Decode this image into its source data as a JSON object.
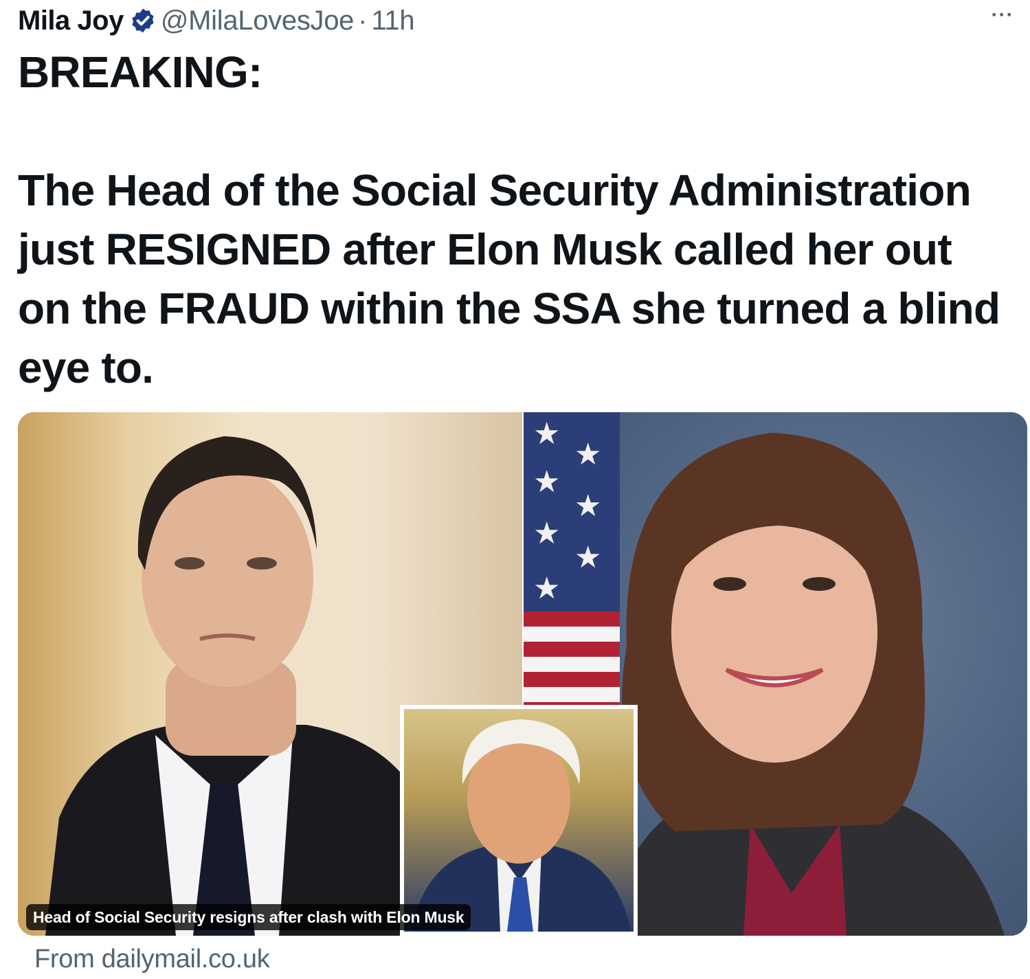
{
  "tweet": {
    "author_name": "Mila Joy",
    "handle": "@MilaLovesJoe",
    "separator": "·",
    "time": "11h",
    "more_label": "···",
    "text": "BREAKING:\n\nThe Head of the Social Security Administration just RESIGNED after Elon Musk called her out on the FRAUD within the SSA she turned a blind eye to."
  },
  "media": {
    "caption": "Head of Social Security resigns after clash with Elon Musk",
    "source": "From dailymail.co.uk"
  },
  "colors": {
    "text_primary": "#0f1419",
    "text_secondary": "#536471",
    "verified_badge": "#1d3b8b"
  },
  "icons": {
    "verified": "verified-badge-icon",
    "more": "more-options-icon"
  }
}
